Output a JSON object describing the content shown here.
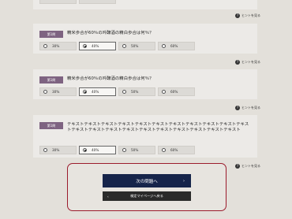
{
  "hint_label": "ヒントを見る",
  "questions": [
    {
      "badge": "第1問",
      "text": "精米歩合が60％の吟醸酒の精白歩合は何％？",
      "options": [
        "30%",
        "40%",
        "50%",
        "60%"
      ],
      "selected_index": 1
    },
    {
      "badge": "第1問",
      "text": "精米歩合が60％の吟醸酒の精白歩合は何％？",
      "options": [
        "30%",
        "40%",
        "50%",
        "60%"
      ],
      "selected_index": 1
    },
    {
      "badge": "第1問",
      "text": "テキストテキストテキストテキストテキストテキストテキストテキストテキストテキストテキストテキストテキストテキストテキストテキストテキストテキストテキストテキストテキスト",
      "options": [
        "30%",
        "40%",
        "50%",
        "60%"
      ],
      "selected_index": 1
    }
  ],
  "actions": {
    "next_label": "次の問題へ",
    "next_chevron": "›",
    "back_label": "検定マイページへ戻る",
    "back_chevron": "‹"
  },
  "colors": {
    "badge": "#7e6381",
    "next_button": "#16244a",
    "back_button": "#2a2a2a",
    "action_border": "#9b1b2c"
  }
}
